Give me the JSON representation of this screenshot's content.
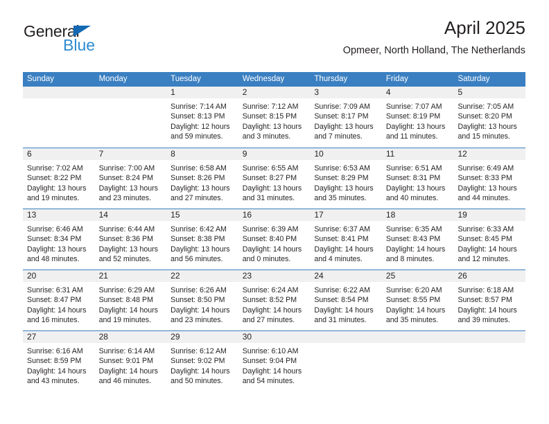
{
  "brand": {
    "name_part1": "General",
    "name_part2": "Blue",
    "triangle_color": "#1268b3",
    "blue_color": "#2e8bd0"
  },
  "header": {
    "title": "April 2025",
    "subtitle": "Opmeer, North Holland, The Netherlands"
  },
  "theme": {
    "header_blue": "#3a7fc1",
    "daynum_band": "#f0f0f0",
    "text": "#231f20"
  },
  "weekdays": [
    "Sunday",
    "Monday",
    "Tuesday",
    "Wednesday",
    "Thursday",
    "Friday",
    "Saturday"
  ],
  "weeks": [
    [
      {
        "day": "",
        "empty": true
      },
      {
        "day": "",
        "empty": true
      },
      {
        "day": "1",
        "sunrise": "Sunrise: 7:14 AM",
        "sunset": "Sunset: 8:13 PM",
        "daylight1": "Daylight: 12 hours",
        "daylight2": "and 59 minutes."
      },
      {
        "day": "2",
        "sunrise": "Sunrise: 7:12 AM",
        "sunset": "Sunset: 8:15 PM",
        "daylight1": "Daylight: 13 hours",
        "daylight2": "and 3 minutes."
      },
      {
        "day": "3",
        "sunrise": "Sunrise: 7:09 AM",
        "sunset": "Sunset: 8:17 PM",
        "daylight1": "Daylight: 13 hours",
        "daylight2": "and 7 minutes."
      },
      {
        "day": "4",
        "sunrise": "Sunrise: 7:07 AM",
        "sunset": "Sunset: 8:19 PM",
        "daylight1": "Daylight: 13 hours",
        "daylight2": "and 11 minutes."
      },
      {
        "day": "5",
        "sunrise": "Sunrise: 7:05 AM",
        "sunset": "Sunset: 8:20 PM",
        "daylight1": "Daylight: 13 hours",
        "daylight2": "and 15 minutes."
      }
    ],
    [
      {
        "day": "6",
        "sunrise": "Sunrise: 7:02 AM",
        "sunset": "Sunset: 8:22 PM",
        "daylight1": "Daylight: 13 hours",
        "daylight2": "and 19 minutes."
      },
      {
        "day": "7",
        "sunrise": "Sunrise: 7:00 AM",
        "sunset": "Sunset: 8:24 PM",
        "daylight1": "Daylight: 13 hours",
        "daylight2": "and 23 minutes."
      },
      {
        "day": "8",
        "sunrise": "Sunrise: 6:58 AM",
        "sunset": "Sunset: 8:26 PM",
        "daylight1": "Daylight: 13 hours",
        "daylight2": "and 27 minutes."
      },
      {
        "day": "9",
        "sunrise": "Sunrise: 6:55 AM",
        "sunset": "Sunset: 8:27 PM",
        "daylight1": "Daylight: 13 hours",
        "daylight2": "and 31 minutes."
      },
      {
        "day": "10",
        "sunrise": "Sunrise: 6:53 AM",
        "sunset": "Sunset: 8:29 PM",
        "daylight1": "Daylight: 13 hours",
        "daylight2": "and 35 minutes."
      },
      {
        "day": "11",
        "sunrise": "Sunrise: 6:51 AM",
        "sunset": "Sunset: 8:31 PM",
        "daylight1": "Daylight: 13 hours",
        "daylight2": "and 40 minutes."
      },
      {
        "day": "12",
        "sunrise": "Sunrise: 6:49 AM",
        "sunset": "Sunset: 8:33 PM",
        "daylight1": "Daylight: 13 hours",
        "daylight2": "and 44 minutes."
      }
    ],
    [
      {
        "day": "13",
        "sunrise": "Sunrise: 6:46 AM",
        "sunset": "Sunset: 8:34 PM",
        "daylight1": "Daylight: 13 hours",
        "daylight2": "and 48 minutes."
      },
      {
        "day": "14",
        "sunrise": "Sunrise: 6:44 AM",
        "sunset": "Sunset: 8:36 PM",
        "daylight1": "Daylight: 13 hours",
        "daylight2": "and 52 minutes."
      },
      {
        "day": "15",
        "sunrise": "Sunrise: 6:42 AM",
        "sunset": "Sunset: 8:38 PM",
        "daylight1": "Daylight: 13 hours",
        "daylight2": "and 56 minutes."
      },
      {
        "day": "16",
        "sunrise": "Sunrise: 6:39 AM",
        "sunset": "Sunset: 8:40 PM",
        "daylight1": "Daylight: 14 hours",
        "daylight2": "and 0 minutes."
      },
      {
        "day": "17",
        "sunrise": "Sunrise: 6:37 AM",
        "sunset": "Sunset: 8:41 PM",
        "daylight1": "Daylight: 14 hours",
        "daylight2": "and 4 minutes."
      },
      {
        "day": "18",
        "sunrise": "Sunrise: 6:35 AM",
        "sunset": "Sunset: 8:43 PM",
        "daylight1": "Daylight: 14 hours",
        "daylight2": "and 8 minutes."
      },
      {
        "day": "19",
        "sunrise": "Sunrise: 6:33 AM",
        "sunset": "Sunset: 8:45 PM",
        "daylight1": "Daylight: 14 hours",
        "daylight2": "and 12 minutes."
      }
    ],
    [
      {
        "day": "20",
        "sunrise": "Sunrise: 6:31 AM",
        "sunset": "Sunset: 8:47 PM",
        "daylight1": "Daylight: 14 hours",
        "daylight2": "and 16 minutes."
      },
      {
        "day": "21",
        "sunrise": "Sunrise: 6:29 AM",
        "sunset": "Sunset: 8:48 PM",
        "daylight1": "Daylight: 14 hours",
        "daylight2": "and 19 minutes."
      },
      {
        "day": "22",
        "sunrise": "Sunrise: 6:26 AM",
        "sunset": "Sunset: 8:50 PM",
        "daylight1": "Daylight: 14 hours",
        "daylight2": "and 23 minutes."
      },
      {
        "day": "23",
        "sunrise": "Sunrise: 6:24 AM",
        "sunset": "Sunset: 8:52 PM",
        "daylight1": "Daylight: 14 hours",
        "daylight2": "and 27 minutes."
      },
      {
        "day": "24",
        "sunrise": "Sunrise: 6:22 AM",
        "sunset": "Sunset: 8:54 PM",
        "daylight1": "Daylight: 14 hours",
        "daylight2": "and 31 minutes."
      },
      {
        "day": "25",
        "sunrise": "Sunrise: 6:20 AM",
        "sunset": "Sunset: 8:55 PM",
        "daylight1": "Daylight: 14 hours",
        "daylight2": "and 35 minutes."
      },
      {
        "day": "26",
        "sunrise": "Sunrise: 6:18 AM",
        "sunset": "Sunset: 8:57 PM",
        "daylight1": "Daylight: 14 hours",
        "daylight2": "and 39 minutes."
      }
    ],
    [
      {
        "day": "27",
        "sunrise": "Sunrise: 6:16 AM",
        "sunset": "Sunset: 8:59 PM",
        "daylight1": "Daylight: 14 hours",
        "daylight2": "and 43 minutes."
      },
      {
        "day": "28",
        "sunrise": "Sunrise: 6:14 AM",
        "sunset": "Sunset: 9:01 PM",
        "daylight1": "Daylight: 14 hours",
        "daylight2": "and 46 minutes."
      },
      {
        "day": "29",
        "sunrise": "Sunrise: 6:12 AM",
        "sunset": "Sunset: 9:02 PM",
        "daylight1": "Daylight: 14 hours",
        "daylight2": "and 50 minutes."
      },
      {
        "day": "30",
        "sunrise": "Sunrise: 6:10 AM",
        "sunset": "Sunset: 9:04 PM",
        "daylight1": "Daylight: 14 hours",
        "daylight2": "and 54 minutes."
      },
      {
        "day": "",
        "empty": true
      },
      {
        "day": "",
        "empty": true
      },
      {
        "day": "",
        "empty": true
      }
    ]
  ]
}
